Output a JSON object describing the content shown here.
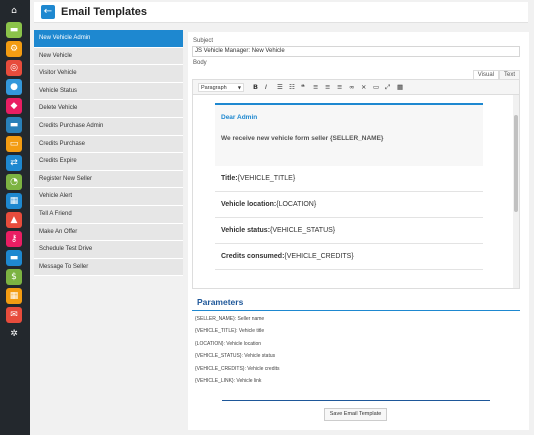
{
  "header": {
    "title": "Email Templates"
  },
  "templates": [
    "New Vehicle Admin",
    "New Vehicle",
    "Visitor Vehicle",
    "Vehicle Status",
    "Delete Vehicle",
    "Credits Purchase Admin",
    "Credits Purchase",
    "Credits Expire",
    "Register New Seller",
    "Vehicle Alert",
    "Tell A Friend",
    "Make An Offer",
    "Schedule Test Drive",
    "Message To Seller"
  ],
  "form": {
    "subject_label": "Subject",
    "subject_value": "JS Vehicle Manager: New Vehicle",
    "body_label": "Body",
    "tabs": [
      "Visual",
      "Text"
    ]
  },
  "toolbar": {
    "format": "Paragraph"
  },
  "email": {
    "greeting": "Dear Admin",
    "intro": "We receive new vehicle form seller {SELLER_NAME}",
    "rows": [
      {
        "label": "Title:",
        "value": "{VEHICLE_TITLE}"
      },
      {
        "label": "Vehicle location:",
        "value": "{LOCATION}"
      },
      {
        "label": "Vehicle status:",
        "value": "{VEHICLE_STATUS}"
      },
      {
        "label": "Credits consumed:",
        "value": "{VEHICLE_CREDITS}"
      }
    ]
  },
  "parameters": {
    "title": "Parameters",
    "items": [
      "{SELLER_NAME}: Seller name",
      "{VEHICLE_TITLE}: Vehicle title",
      "{LOCATION}: Vehicle location",
      "{VEHICLE_STATUS}: Vehicle status",
      "{VEHICLE_CREDITS}: Vehicle credits",
      "{VEHICLE_LINK}: Vehicle link"
    ]
  },
  "actions": {
    "save_label": "Save Email Template"
  },
  "colors": {
    "accent": "#1e88d0",
    "rail": "#23282d",
    "params_title": "#1e5799"
  },
  "rail_icons": [
    {
      "name": "home-icon",
      "glyph": "⌂",
      "color": "#23282d"
    },
    {
      "name": "car-icon",
      "glyph": "▬",
      "color": "#8bc34a"
    },
    {
      "name": "cog-icon",
      "glyph": "⚙",
      "color": "#f39c12"
    },
    {
      "name": "steering-icon",
      "glyph": "◎",
      "color": "#e74c3c"
    },
    {
      "name": "user-icon",
      "glyph": "●",
      "color": "#3498db"
    },
    {
      "name": "vehicle-type-icon",
      "glyph": "◆",
      "color": "#e91e63"
    },
    {
      "name": "vehicles-icon",
      "glyph": "▬",
      "color": "#2980b9"
    },
    {
      "name": "garage-icon",
      "glyph": "▭",
      "color": "#f39c12"
    },
    {
      "name": "share-icon",
      "glyph": "⇄",
      "color": "#1e88d0"
    },
    {
      "name": "gauge-icon",
      "glyph": "◔",
      "color": "#7cb342"
    },
    {
      "name": "calendar-icon",
      "glyph": "▦",
      "color": "#1e88d0"
    },
    {
      "name": "seller-icon",
      "glyph": "▲",
      "color": "#e74c3c"
    },
    {
      "name": "key-icon",
      "glyph": "⚷",
      "color": "#e91e63"
    },
    {
      "name": "car-list-icon",
      "glyph": "▬",
      "color": "#1e88d0"
    },
    {
      "name": "credits-icon",
      "glyph": "$",
      "color": "#7cb342"
    },
    {
      "name": "grid-icon",
      "glyph": "▦",
      "color": "#f39c12"
    },
    {
      "name": "mail-icon",
      "glyph": "✉",
      "color": "#e74c3c"
    },
    {
      "name": "wheel-icon",
      "glyph": "✲",
      "color": "#23282d"
    }
  ]
}
